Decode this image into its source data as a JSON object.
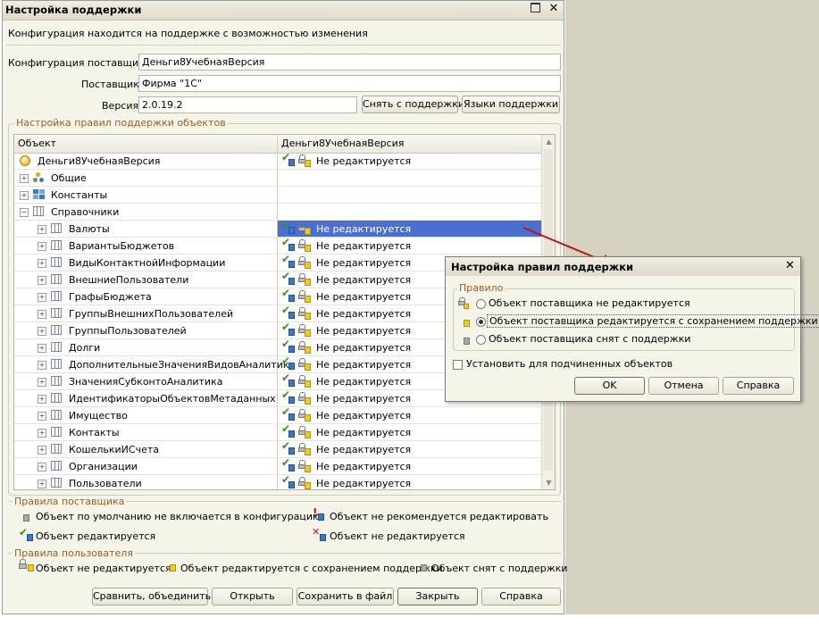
{
  "window": {
    "title": "Настройка поддержки",
    "subtitle": "Конфигурация находится на поддержке с возможностью изменения"
  },
  "vendor": {
    "config_label": "Конфигурация поставщика:",
    "config_value": "Деньги8УчебнаяВерсия",
    "supplier_label": "Поставщик:",
    "supplier_value": "Фирма \"1С\"",
    "version_label": "Версия:",
    "version_value": "2.0.19.2",
    "remove_support_button": "Снять с поддержки",
    "languages_button": "Языки поддержки"
  },
  "rules_group": {
    "title": "Настройка правил поддержки объектов",
    "col_object": "Объект",
    "col_config": "Деньги8УчебнаяВерсия",
    "rows": [
      {
        "name": "Деньги8УчебнаяВерсия",
        "status": "Не редактируется",
        "level": 0,
        "icon": "config-icon",
        "expand": ""
      },
      {
        "name": "Общие",
        "status": "",
        "level": 1,
        "icon": "common-icon",
        "expand": "+"
      },
      {
        "name": "Константы",
        "status": "",
        "level": 1,
        "icon": "constants-icon",
        "expand": "+"
      },
      {
        "name": "Справочники",
        "status": "",
        "level": 1,
        "icon": "catalog-icon",
        "expand": "-"
      },
      {
        "name": "Валюты",
        "status": "Не редактируется",
        "level": 2,
        "icon": "catalog-icon",
        "expand": "+",
        "selected": true
      },
      {
        "name": "ВариантыБюджетов",
        "status": "Не редактируется",
        "level": 2,
        "icon": "catalog-icon",
        "expand": "+"
      },
      {
        "name": "ВидыКонтактнойИнформации",
        "status": "Не редактируется",
        "level": 2,
        "icon": "catalog-icon",
        "expand": "+"
      },
      {
        "name": "ВнешниеПользователи",
        "status": "Не редактируется",
        "level": 2,
        "icon": "catalog-icon",
        "expand": "+"
      },
      {
        "name": "ГрафыБюджета",
        "status": "Не редактируется",
        "level": 2,
        "icon": "catalog-icon",
        "expand": "+"
      },
      {
        "name": "ГруппыВнешнихПользователей",
        "status": "Не редактируется",
        "level": 2,
        "icon": "catalog-icon",
        "expand": "+"
      },
      {
        "name": "ГруппыПользователей",
        "status": "Не редактируется",
        "level": 2,
        "icon": "catalog-icon",
        "expand": "+"
      },
      {
        "name": "Долги",
        "status": "Не редактируется",
        "level": 2,
        "icon": "catalog-icon",
        "expand": "+"
      },
      {
        "name": "ДополнительныеЗначенияВидовАналитик",
        "status": "Не редактируется",
        "level": 2,
        "icon": "catalog-icon",
        "expand": "+"
      },
      {
        "name": "ЗначенияСубконтоАналитика",
        "status": "Не редактируется",
        "level": 2,
        "icon": "catalog-icon",
        "expand": "+"
      },
      {
        "name": "ИдентификаторыОбъектовМетаданных",
        "status": "Не редактируется",
        "level": 2,
        "icon": "catalog-icon",
        "expand": "+"
      },
      {
        "name": "Имущество",
        "status": "Не редактируется",
        "level": 2,
        "icon": "catalog-icon",
        "expand": "+"
      },
      {
        "name": "Контакты",
        "status": "Не редактируется",
        "level": 2,
        "icon": "catalog-icon",
        "expand": "+"
      },
      {
        "name": "КошелькиИСчета",
        "status": "Не редактируется",
        "level": 2,
        "icon": "catalog-icon",
        "expand": "+"
      },
      {
        "name": "Организации",
        "status": "Не редактируется",
        "level": 2,
        "icon": "catalog-icon",
        "expand": "+"
      },
      {
        "name": "Пользователи",
        "status": "Не редактируется",
        "level": 2,
        "icon": "catalog-icon",
        "expand": "+"
      }
    ]
  },
  "legend": {
    "vendor_title": "Правила поставщика",
    "vendor_not_included": "Объект по умолчанию не включается в конфигурацию",
    "vendor_not_recommended": "Объект не рекомендуется редактировать",
    "vendor_editable": "Объект редактируется",
    "vendor_not_editable": "Объект не редактируется",
    "user_title": "Правила пользователя",
    "user_not_editable": "Объект не редактируется",
    "user_editable_keep": "Объект редактируется с сохранением поддержки",
    "user_removed": "Объект снят с поддержки"
  },
  "footer": {
    "compare": "Сравнить, объединить",
    "open": "Открыть",
    "save": "Сохранить в файл",
    "close": "Закрыть",
    "help": "Справка"
  },
  "dialog": {
    "title": "Настройка правил поддержки",
    "group_title": "Правило",
    "opt1": "Объект поставщика не редактируется",
    "opt2": "Объект поставщика редактируется с сохранением поддержки",
    "opt3": "Объект поставщика снят с поддержки",
    "selected_option": 2,
    "apply_children": "Установить для подчиненных объектов",
    "ok": "OK",
    "cancel": "Отмена",
    "help": "Справка"
  },
  "colors": {
    "window_bg": "#f5f4e9",
    "desktop_bg": "#d6d2c2",
    "group_title": "#a15b1b",
    "selection": "#4a6fd0",
    "arrow": "#c0141b"
  }
}
